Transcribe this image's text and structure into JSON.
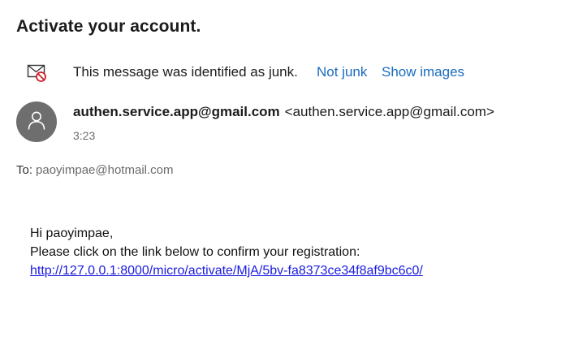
{
  "message": {
    "subject": "Activate your account.",
    "junk_notice": "This message was identified as junk.",
    "not_junk_label": "Not junk",
    "show_images_label": "Show images",
    "sender_name": "authen.service.app@gmail.com",
    "sender_address": "<authen.service.app@gmail.com>",
    "time": "3:23",
    "to_label": "To:",
    "to_address": "paoyimpae@hotmail.com",
    "body": {
      "greeting": "Hi paoyimpae,",
      "instruction": "Please click on the link below to confirm your registration:",
      "link": "http://127.0.0.1:8000/micro/activate/MjA/5bv-fa8373ce34f8af9bc6c0/"
    }
  },
  "icons": {
    "junk": "junk-mail-icon",
    "avatar": "person-icon"
  },
  "colors": {
    "link_blue": "#1a6bbf",
    "body_link": "#1a1ae0",
    "avatar_bg": "#6e6e6e"
  }
}
